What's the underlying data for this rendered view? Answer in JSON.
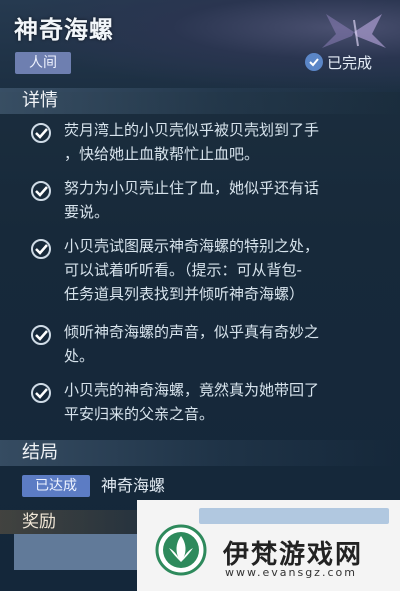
{
  "quest": {
    "title": "神奇海螺",
    "category_tag": "人间",
    "status": "已完成"
  },
  "details": {
    "heading": "详情",
    "items": [
      {
        "line1": "荧月湾上的小贝壳似乎被贝壳划到了手",
        "line2": "，快给她止血散帮忙止血吧。",
        "line3": ""
      },
      {
        "line1": "努力为小贝壳止住了血，她似乎还有话",
        "line2": "要说。",
        "line3": ""
      },
      {
        "line1": "小贝壳试图展示神奇海螺的特别之处，",
        "line2": "可以试着听听看。（提示：可从背包-",
        "line3": "任务道具列表找到并倾听神奇海螺）"
      },
      {
        "line1": "倾听神奇海螺的声音，似乎真有奇妙之",
        "line2": "处。",
        "line3": ""
      },
      {
        "line1": "小贝壳的神奇海螺，竟然真为她带回了",
        "line2": "平安归来的父亲之音。",
        "line3": ""
      }
    ]
  },
  "ending": {
    "heading": "结局",
    "badge": "已达成",
    "name": "神奇海螺"
  },
  "reward": {
    "heading": "奖励"
  },
  "watermark": {
    "name": "伊梵游戏网",
    "url": "www.evansgz.com"
  },
  "colors": {
    "accent_blue": "#5c7cc4",
    "tag_purple": "#6e7fb0",
    "background": "#17293a"
  }
}
